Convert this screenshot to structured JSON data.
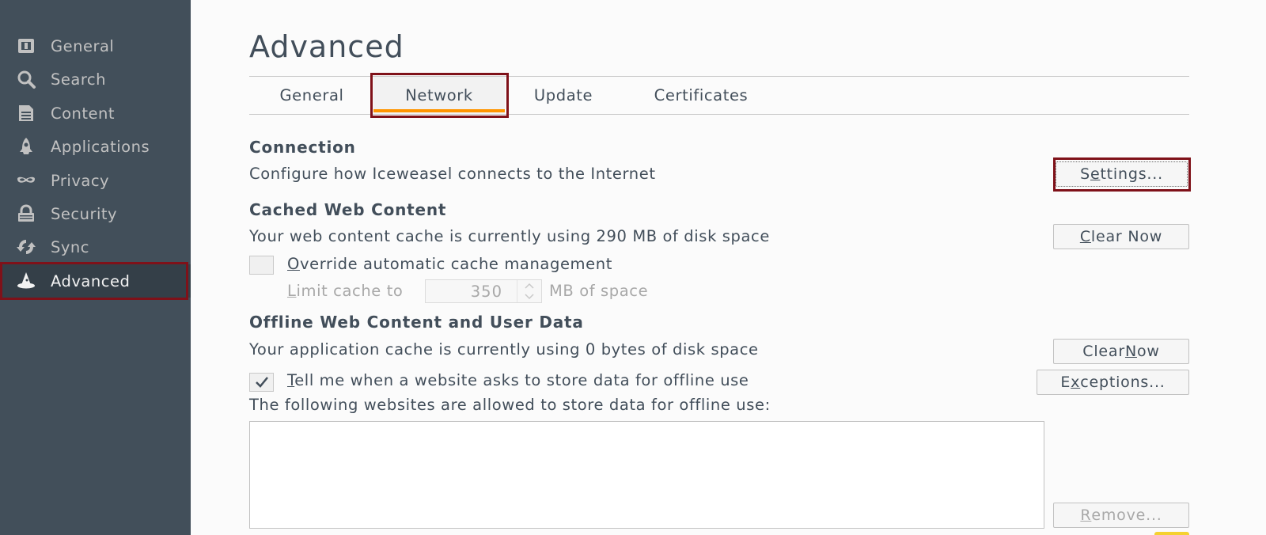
{
  "sidebar": {
    "items": [
      {
        "label": "General",
        "icon": "general-icon"
      },
      {
        "label": "Search",
        "icon": "search-icon"
      },
      {
        "label": "Content",
        "icon": "content-icon"
      },
      {
        "label": "Applications",
        "icon": "applications-icon"
      },
      {
        "label": "Privacy",
        "icon": "privacy-mask-icon"
      },
      {
        "label": "Security",
        "icon": "security-icon"
      },
      {
        "label": "Sync",
        "icon": "sync-icon"
      },
      {
        "label": "Advanced",
        "icon": "advanced-wizard-icon",
        "selected": true
      }
    ]
  },
  "page": {
    "title": "Advanced",
    "tabs": [
      {
        "label": "General"
      },
      {
        "label": "Network",
        "selected": true
      },
      {
        "label": "Update"
      },
      {
        "label": "Certificates"
      }
    ]
  },
  "connection": {
    "title": "Connection",
    "description": "Configure how Iceweasel connects to the Internet",
    "settings_button": {
      "pre": "S",
      "ul": "e",
      "post": "ttings..."
    }
  },
  "cache": {
    "title": "Cached Web Content",
    "description": "Your web content cache is currently using 290 MB of disk space",
    "clear_button": {
      "pre": "",
      "ul": "C",
      "post": "lear Now"
    },
    "override_checkbox": {
      "pre": "",
      "ul": "O",
      "post": "verride automatic cache management",
      "checked": false
    },
    "limit": {
      "pre": "",
      "ul": "L",
      "post": "imit cache to",
      "value": "350",
      "unit": "MB of space"
    }
  },
  "offline": {
    "title": "Offline Web Content and User Data",
    "description": "Your application cache is currently using 0 bytes of disk space",
    "clear_button": {
      "pre": "Clear ",
      "ul": "N",
      "post": "ow"
    },
    "tell_checkbox": {
      "pre": "",
      "ul": "T",
      "post": "ell me when a website asks to store data for offline use",
      "checked": true
    },
    "exceptions_button": {
      "pre": "E",
      "ul": "x",
      "post": "ceptions..."
    },
    "allowed_label": "The following websites are allowed to store data for offline use:",
    "remove_button": {
      "pre": "",
      "ul": "R",
      "post": "emove..."
    }
  },
  "colors": {
    "sidebar_bg": "#424f5a",
    "sidebar_selected_bg": "#343f48",
    "accent_tab_underline": "#ff9500",
    "highlight_border": "#7f1119"
  }
}
